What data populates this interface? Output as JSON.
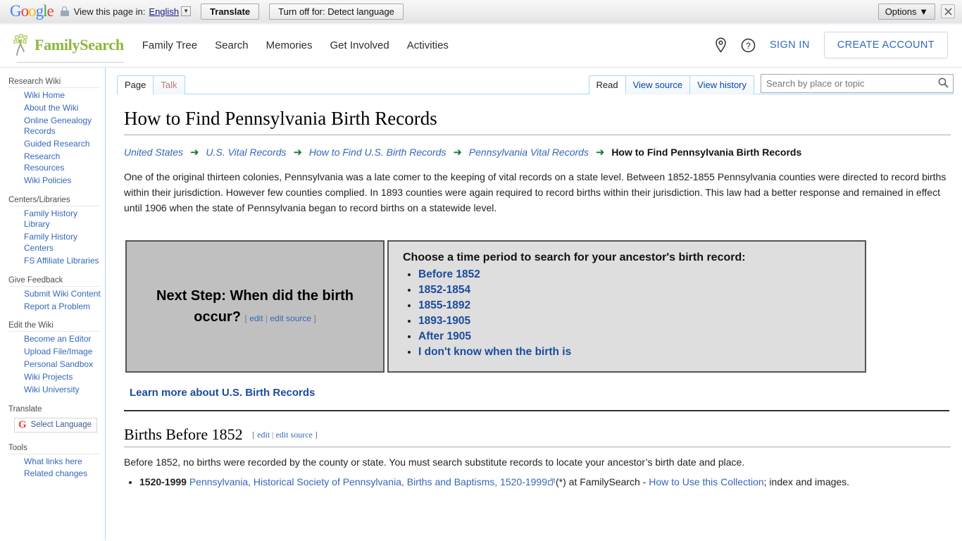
{
  "translate_bar": {
    "brand": "Google",
    "lock_icon": "lock-icon",
    "view_label": "View this page in:",
    "language": "English",
    "translate_button": "Translate",
    "turn_off_button": "Turn off for: Detect language",
    "options_button": "Options",
    "options_caret": "▼",
    "close_icon": "×"
  },
  "header": {
    "brand": "FamilySearch",
    "nav": [
      {
        "label": "Family Tree"
      },
      {
        "label": "Search"
      },
      {
        "label": "Memories"
      },
      {
        "label": "Get Involved"
      },
      {
        "label": "Activities"
      }
    ],
    "location_icon": "map-pin-icon",
    "help_icon": "help-circle-icon",
    "sign_in": "SIGN IN",
    "create_account": "CREATE ACCOUNT",
    "brand_color": "#8cb63c",
    "link_color": "#2f6bbf"
  },
  "sidebar": {
    "groups": [
      {
        "heading": "Research Wiki",
        "items": [
          {
            "label": "Wiki Home"
          },
          {
            "label": "About the Wiki"
          },
          {
            "label": "Online Genealogy Records"
          },
          {
            "label": "Guided Research"
          },
          {
            "label": "Research Resources"
          },
          {
            "label": "Wiki Policies"
          }
        ]
      },
      {
        "heading": "Centers/Libraries",
        "items": [
          {
            "label": "Family History Library"
          },
          {
            "label": "Family History Centers"
          },
          {
            "label": "FS Affiliate Libraries"
          }
        ]
      },
      {
        "heading": "Give Feedback",
        "items": [
          {
            "label": "Submit Wiki Content"
          },
          {
            "label": "Report a Problem"
          }
        ]
      },
      {
        "heading": "Edit the Wiki",
        "items": [
          {
            "label": "Become an Editor"
          },
          {
            "label": "Upload File/Image"
          },
          {
            "label": "Personal Sandbox"
          },
          {
            "label": "Wiki Projects"
          },
          {
            "label": "Wiki University"
          }
        ]
      }
    ],
    "translate_heading": "Translate",
    "select_language": "Select Language",
    "tools_heading": "Tools",
    "tools_items": [
      {
        "label": "What links here"
      },
      {
        "label": "Related changes"
      }
    ]
  },
  "tabs": {
    "left": [
      {
        "label": "Page",
        "selected": true
      },
      {
        "label": "Talk",
        "selected": false,
        "style": "newlink"
      }
    ],
    "right": [
      {
        "label": "Read",
        "selected": true
      },
      {
        "label": "View source",
        "selected": false
      },
      {
        "label": "View history",
        "selected": false
      }
    ]
  },
  "search": {
    "placeholder": "Search by place or topic",
    "value": "",
    "icon": "search-icon"
  },
  "article": {
    "title": "How to Find Pennsylvania Birth Records",
    "breadcrumb": [
      {
        "label": "United States",
        "link": true
      },
      {
        "label": "U.S. Vital Records",
        "link": true
      },
      {
        "label": "How to Find U.S. Birth Records",
        "link": true
      },
      {
        "label": "Pennsylvania Vital Records",
        "link": true
      },
      {
        "label": "How to Find Pennsylvania Birth Records",
        "link": false
      }
    ],
    "breadcrumb_arrow": "➜",
    "lede": "One of the original thirteen colonies, Pennsylvania was a late comer to the keeping of vital records on a state level. Between 1852-1855 Pennsylvania counties were directed to record births within their jurisdiction. However few counties complied. In 1893 counties were again required to record births within their jurisdiction. This law had a better response and remained in effect until 1906 when the state of Pennsylvania began to record births on a statewide level.",
    "next_step": {
      "left_title": "Next Step: When did the birth occur?",
      "edit_label": "edit",
      "edit_source_label": "edit source",
      "bracket_open": "[",
      "bracket_close": "]",
      "separator": "|",
      "question": "Choose a time period to search for your ancestor's birth record:",
      "options": [
        {
          "label": "Before 1852"
        },
        {
          "label": "1852-1854"
        },
        {
          "label": "1855-1892"
        },
        {
          "label": "1893-1905"
        },
        {
          "label": "After 1905"
        },
        {
          "label": "I don't know when the birth is"
        }
      ]
    },
    "learn_more": "Learn more about U.S. Birth Records",
    "section": {
      "heading": "Births Before 1852",
      "edit_label": "edit",
      "edit_source_label": "edit source",
      "paragraph": "Before 1852, no births were recorded by the county or state. You must search substitute records to locate your ancestor’s birth date and place.",
      "bullets": [
        {
          "years": "1520-1999",
          "link_text": "Pennsylvania, Historical Society of Pennsylvania, Births and Baptisms, 1520-1999",
          "after_link": "(*) at FamilySearch - ",
          "second_link": "How to Use this Collection",
          "tail": "; index and images."
        }
      ]
    }
  }
}
